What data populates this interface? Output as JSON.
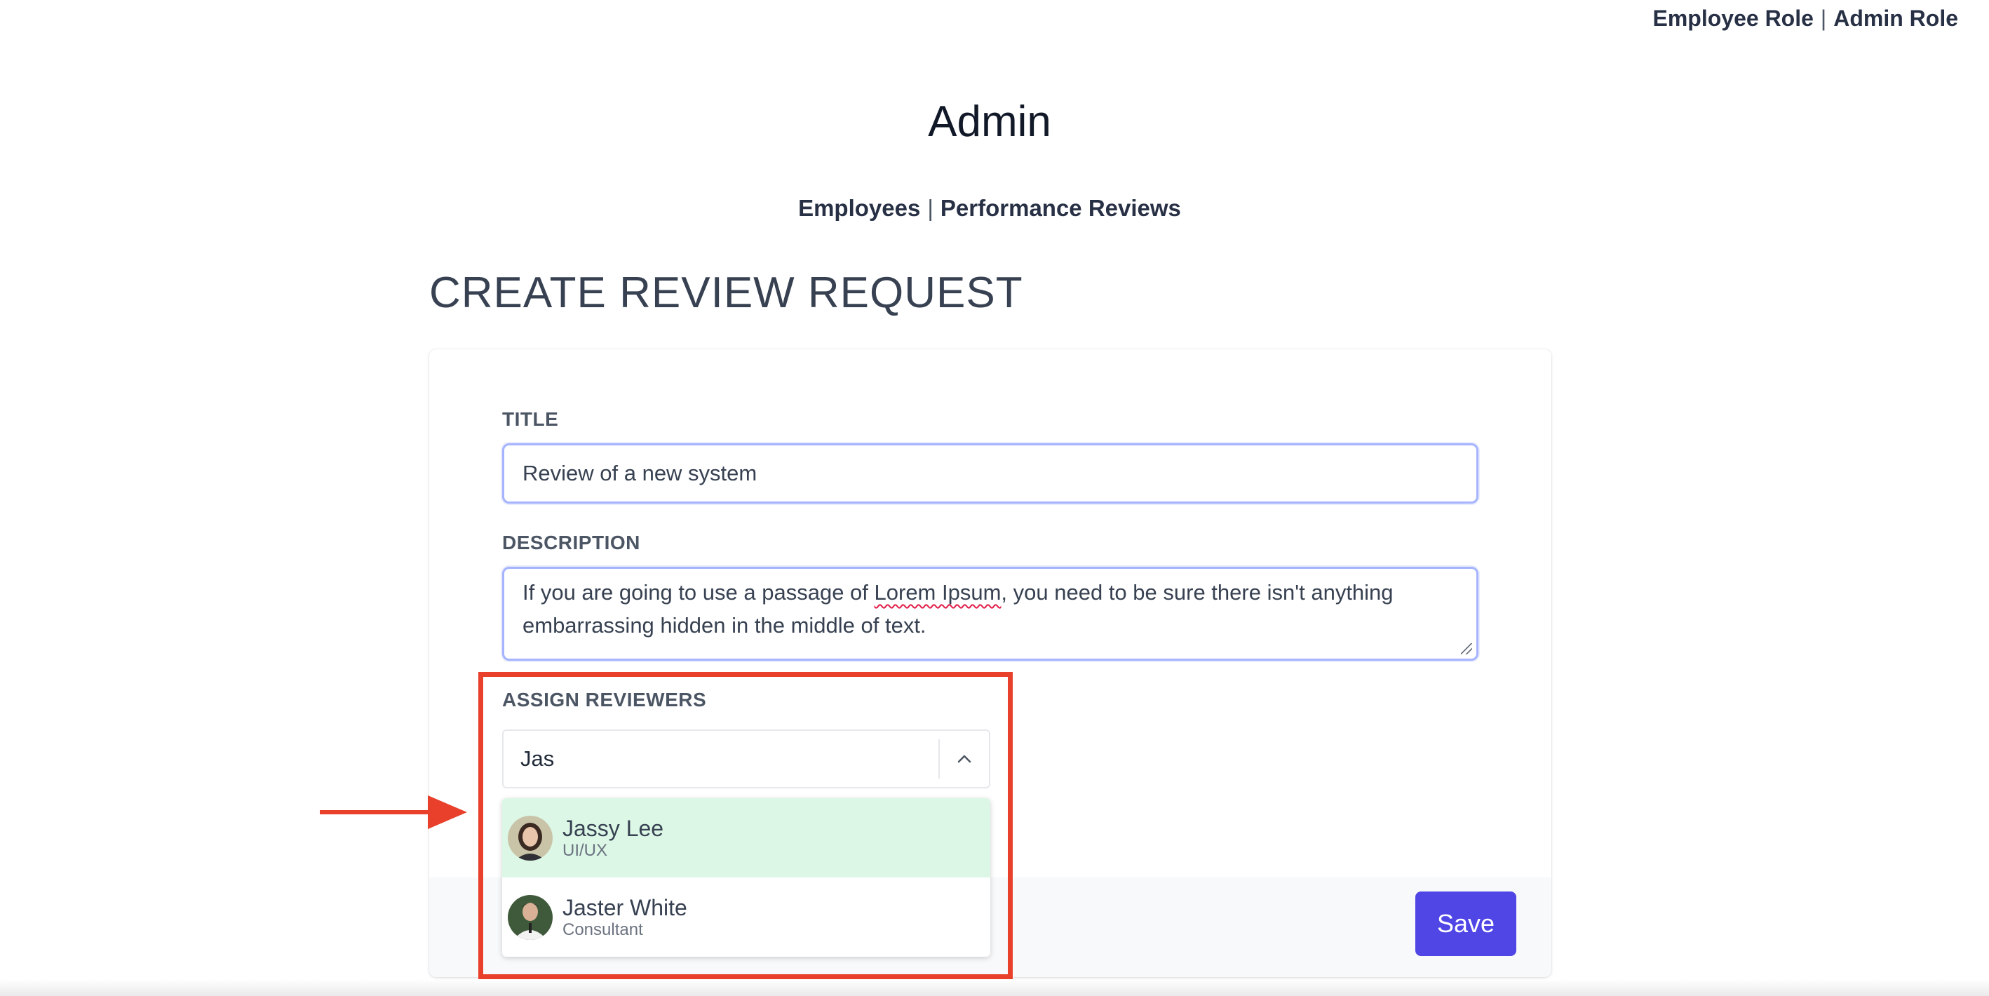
{
  "role_nav": {
    "employee": "Employee Role",
    "separator": "|",
    "admin": "Admin Role"
  },
  "site_title": "Admin",
  "sub_nav": {
    "employees": "Employees",
    "separator": "|",
    "reviews": "Performance Reviews"
  },
  "page_heading": "CREATE REVIEW REQUEST",
  "form": {
    "title_label": "TITLE",
    "title_value": "Review of a new system",
    "description_label": "DESCRIPTION",
    "description_before": "If you are going to use a passage of ",
    "description_misspelled": "Lorem Ipsum",
    "description_after": ", you need to be sure there isn't anything embarrassing hidden in the middle of text.",
    "reviewers_label": "ASSIGN REVIEWERS",
    "reviewers_search": "Jas",
    "reviewer_options": [
      {
        "name": "Jassy Lee",
        "role": "UI/UX",
        "highlighted": true
      },
      {
        "name": "Jaster White",
        "role": "Consultant",
        "highlighted": false
      }
    ],
    "save_label": "Save"
  },
  "icons": {
    "toggle": "chevron-up-icon",
    "annotation": "arrow-right-icon"
  },
  "colors": {
    "accent": "#4f46e5",
    "focus_border": "#a5b4fc",
    "option_highlight": "#dcf7e6",
    "annotation": "#e8402b"
  }
}
